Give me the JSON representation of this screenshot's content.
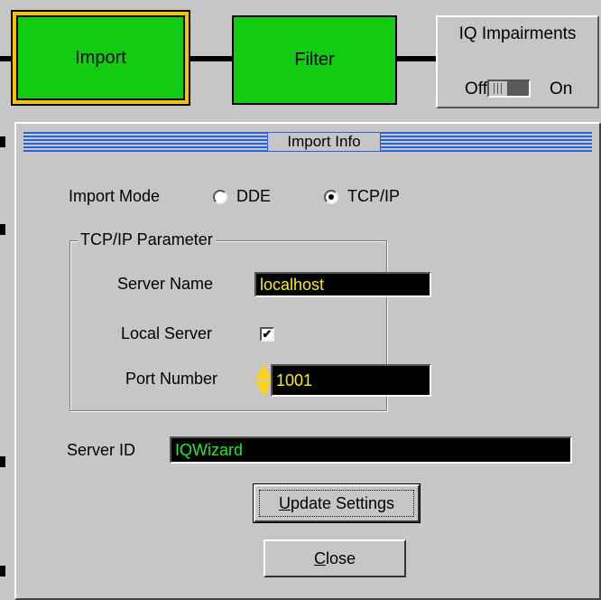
{
  "flow": {
    "import_label": "Import",
    "filter_label": "Filter",
    "iq_title": "IQ Impairments",
    "iq_off": "Off",
    "iq_on": "On",
    "iq_state": "Off"
  },
  "dialog": {
    "title": "Import Info",
    "import_mode_label": "Import Mode",
    "modes": [
      {
        "label": "DDE",
        "selected": false
      },
      {
        "label": "TCP/IP",
        "selected": true
      }
    ],
    "group_title": "TCP/IP Parameter",
    "server_name_label": "Server Name",
    "server_name_value": "localhost",
    "local_server_label": "Local Server",
    "local_server_checked": true,
    "port_number_label": "Port Number",
    "port_number_value": "1001",
    "server_id_label": "Server ID",
    "server_id_value": "IQWizard",
    "update_button": {
      "mnemonic": "U",
      "rest": "pdate Settings"
    },
    "close_button": {
      "mnemonic": "C",
      "rest": "lose"
    }
  },
  "colors": {
    "block_green": "#11cc11",
    "selection_orange": "#ffc000",
    "field_bg": "#000000",
    "text_yellow": "#ffee00",
    "text_green": "#22e82a",
    "title_stripe": "#2a60d8"
  }
}
